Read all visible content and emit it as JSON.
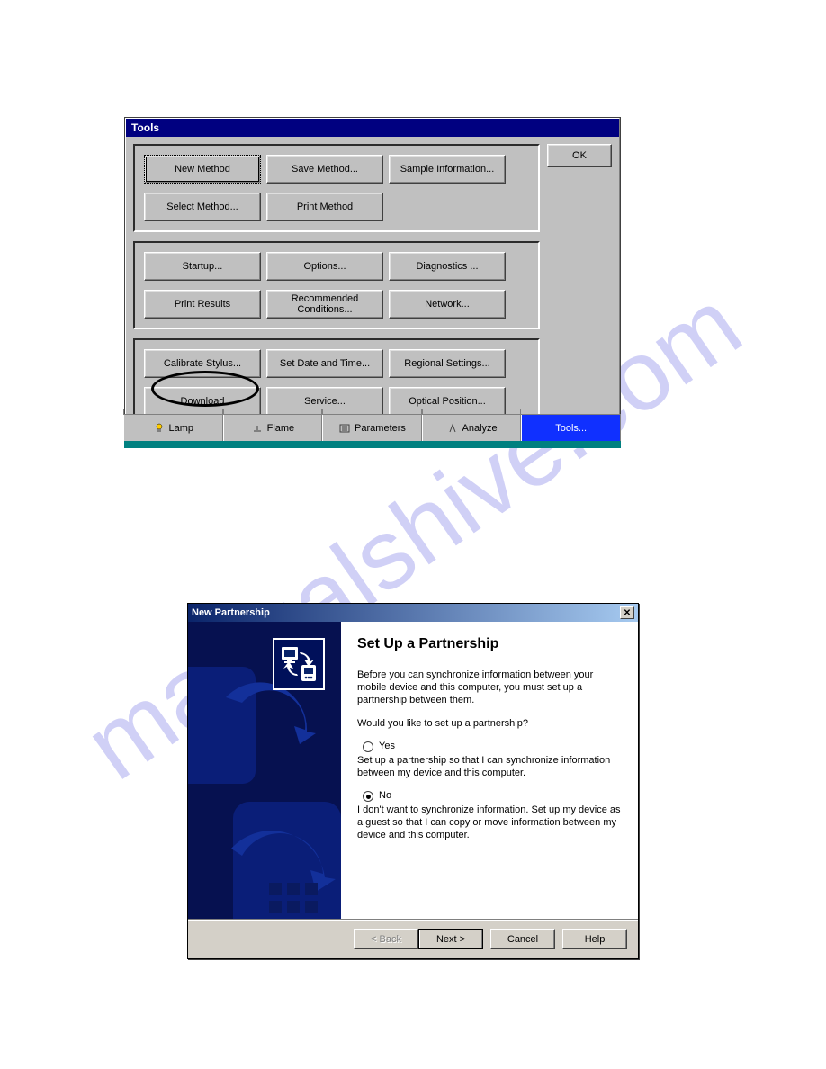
{
  "win1": {
    "title": "Tools",
    "ok": "OK",
    "group1": [
      "New Method",
      "Save Method...",
      "Sample Information...",
      "Select Method...",
      "Print Method"
    ],
    "group2": [
      "Startup...",
      "Options...",
      "Diagnostics ...",
      "Print Results",
      "Recommended Conditions...",
      "Network..."
    ],
    "group3": [
      "Calibrate Stylus...",
      "Set Date and Time...",
      "Regional Settings...",
      "Download",
      "Service...",
      "Optical Position..."
    ]
  },
  "tabs": [
    "Lamp",
    "Flame",
    "Parameters",
    "Analyze",
    "Tools..."
  ],
  "win2": {
    "title": "New Partnership",
    "heading": "Set Up a Partnership",
    "intro": "Before you can synchronize information between your mobile device and this computer, you must set up a partnership between them.",
    "question": "Would you like to set up a partnership?",
    "yes_label": "Yes",
    "yes_desc": "Set up a partnership so that I can synchronize information between my device and this computer.",
    "no_label": "No",
    "no_desc": "I don't want to synchronize information. Set up my device as a guest so that I can copy or move information between my device and this computer.",
    "buttons": {
      "back": "< Back",
      "next": "Next >",
      "cancel": "Cancel",
      "help": "Help"
    }
  },
  "watermark": "manualshive.com"
}
